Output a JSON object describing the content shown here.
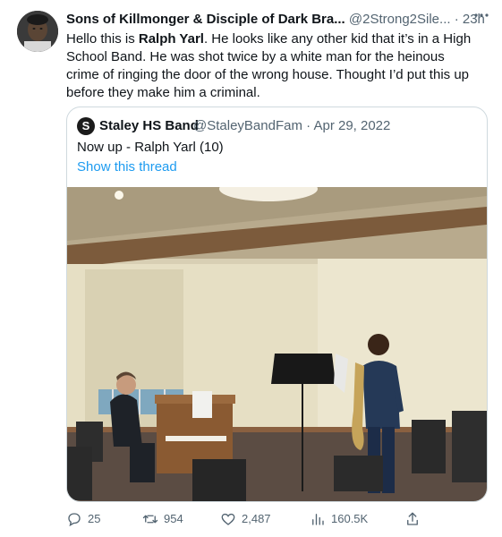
{
  "tweet": {
    "author_name": "Sons of Killmonger & Disciple of Dark Bra...",
    "author_handle": "@2Strong2Sile...",
    "separator": "·",
    "time": "23h",
    "more_icon": "more-icon",
    "text_part1": "Hello this is ",
    "text_bold": "Ralph Yarl",
    "text_part2": ". He looks like any other kid that it’s in a High School Band. He was shot twice by a white man for the heinous crime of ringing the door of the wrong house. Thought I’d put this up before they make him a criminal."
  },
  "quoted": {
    "author_name": "Staley HS Band",
    "author_handle": "@StaleyBandFam",
    "separator": "·",
    "date": "Apr 29, 2022",
    "text": "Now up - Ralph Yarl (10)",
    "show_thread": "Show this thread",
    "logo_letter": "S"
  },
  "actions": {
    "reply_count": "25",
    "retweet_count": "954",
    "like_count": "2,487",
    "views_count": "160.5K"
  },
  "colors": {
    "link": "#1d9bf0",
    "secondary_text": "#536471",
    "border": "#cfd9de"
  }
}
